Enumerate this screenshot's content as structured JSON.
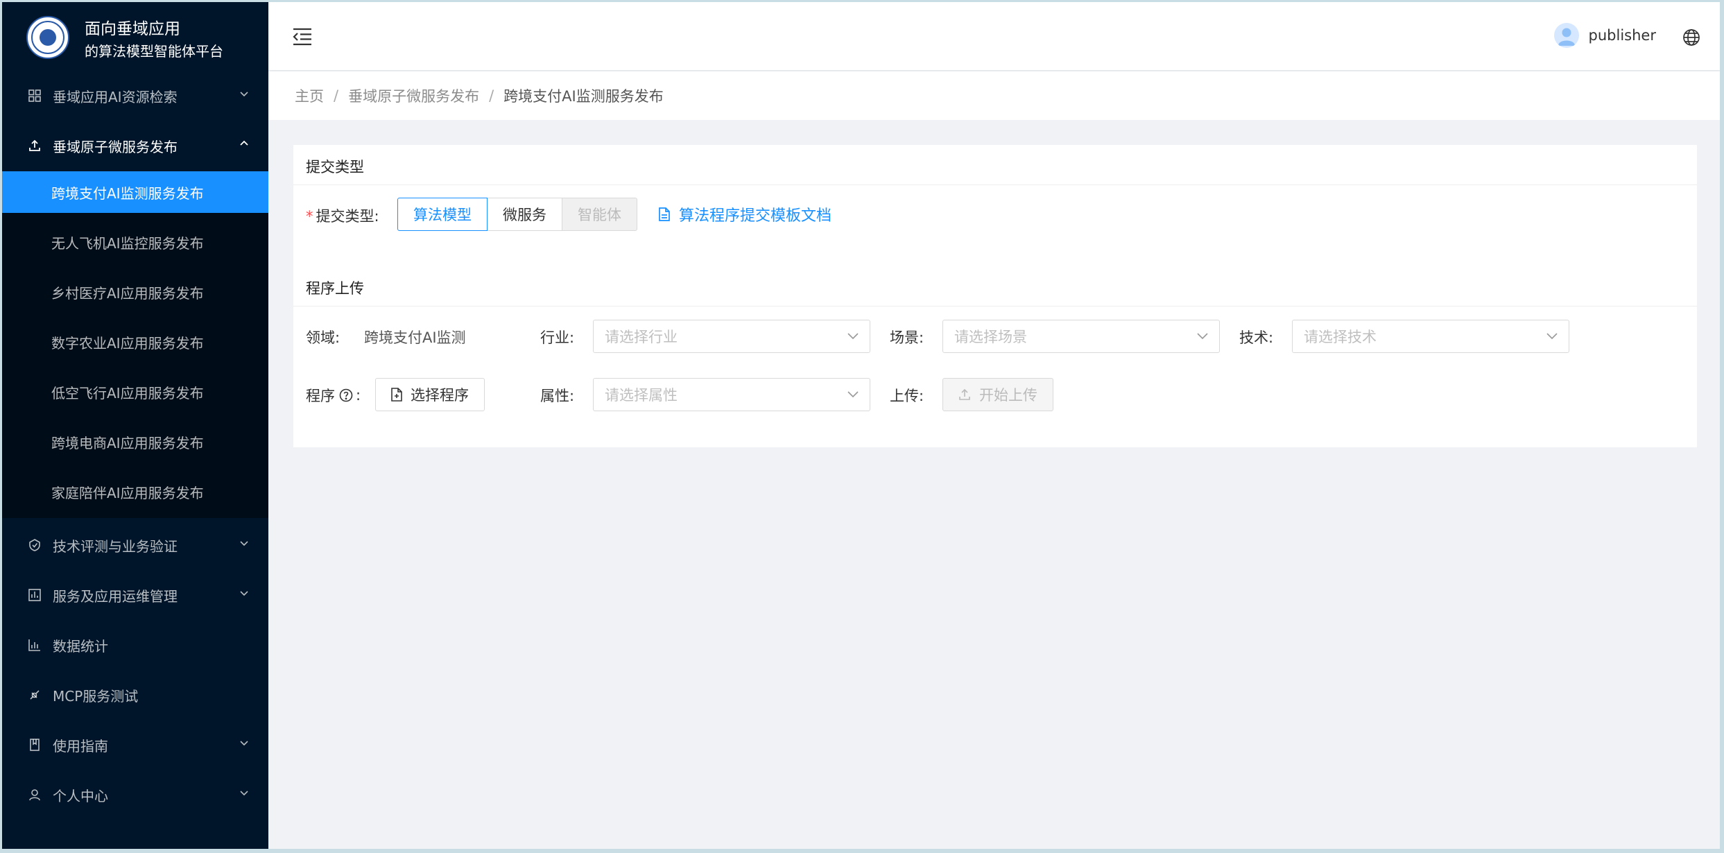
{
  "brand": {
    "line1": "面向垂域应用",
    "line2": "的算法模型智能体平台"
  },
  "sidebar": {
    "items": [
      {
        "label": "垂域应用AI资源检索",
        "icon": "grid-icon"
      },
      {
        "label": "垂域原子微服务发布",
        "icon": "upload-icon"
      },
      {
        "label": "技术评测与业务验证",
        "icon": "badge-icon"
      },
      {
        "label": "服务及应用运维管理",
        "icon": "dashboard-icon"
      },
      {
        "label": "数据统计",
        "icon": "bar-chart-icon"
      },
      {
        "label": "MCP服务测试",
        "icon": "api-icon"
      },
      {
        "label": "使用指南",
        "icon": "book-icon"
      },
      {
        "label": "个人中心",
        "icon": "user-icon"
      }
    ],
    "submenu": [
      "跨境支付AI监测服务发布",
      "无人飞机AI监控服务发布",
      "乡村医疗AI应用服务发布",
      "数字农业AI应用服务发布",
      "低空飞行AI应用服务发布",
      "跨境电商AI应用服务发布",
      "家庭陪伴AI应用服务发布"
    ]
  },
  "header": {
    "username": "publisher"
  },
  "breadcrumb": {
    "home": "主页",
    "parent": "垂域原子微服务发布",
    "current": "跨境支付AI监测服务发布"
  },
  "form": {
    "section1_title": "提交类型",
    "submit_type_label": "提交类型:",
    "types": [
      "算法模型",
      "微服务",
      "智能体"
    ],
    "doc_link": "算法程序提交模板文档",
    "section2_title": "程序上传",
    "domain_label": "领域:",
    "domain_value": "跨境支付AI监测",
    "industry_label": "行业:",
    "industry_placeholder": "请选择行业",
    "scene_label": "场景:",
    "scene_placeholder": "请选择场景",
    "tech_label": "技术:",
    "tech_placeholder": "请选择技术",
    "program_label": "程序",
    "program_colon": ":",
    "select_program": "选择程序",
    "attr_label": "属性:",
    "attr_placeholder": "请选择属性",
    "upload_label": "上传:",
    "start_upload": "开始上传"
  },
  "colors": {
    "sidebar_bg": "#001529",
    "submenu_bg": "#000c17",
    "primary": "#1890ff"
  }
}
